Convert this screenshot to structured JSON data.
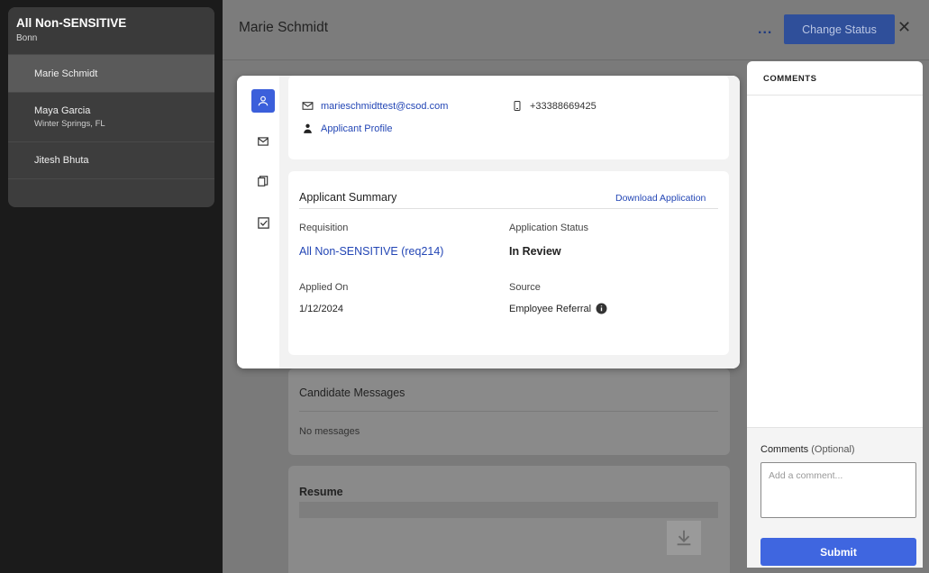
{
  "sidebar": {
    "requisition_title": "All Non-SENSITIVE",
    "location": "Bonn",
    "candidates": [
      {
        "name": "Marie Schmidt",
        "sub": ""
      },
      {
        "name": "Maya Garcia",
        "sub": "Winter Springs, FL"
      },
      {
        "name": "Jitesh Bhuta",
        "sub": ""
      }
    ]
  },
  "header": {
    "title": "Marie Schmidt",
    "more": "...",
    "change_status": "Change Status",
    "close": "✕"
  },
  "contact": {
    "email": "marieschmidttest@csod.com",
    "phone": "+33388669425",
    "profile_link": "Applicant Profile"
  },
  "summary": {
    "title": "Applicant Summary",
    "download": "Download Application",
    "requisition_label": "Requisition",
    "requisition_value": "All Non-SENSITIVE (req214)",
    "status_label": "Application Status",
    "status_value": "In Review",
    "applied_label": "Applied On",
    "applied_value": "1/12/2024",
    "source_label": "Source",
    "source_value": "Employee Referral"
  },
  "background": {
    "messages_title": "Candidate Messages",
    "messages_empty": "No messages",
    "resume_title": "Resume"
  },
  "comments": {
    "title": "COMMENTS",
    "label": "Comments",
    "optional": "(Optional)",
    "placeholder": "Add a comment...",
    "submit": "Submit"
  }
}
